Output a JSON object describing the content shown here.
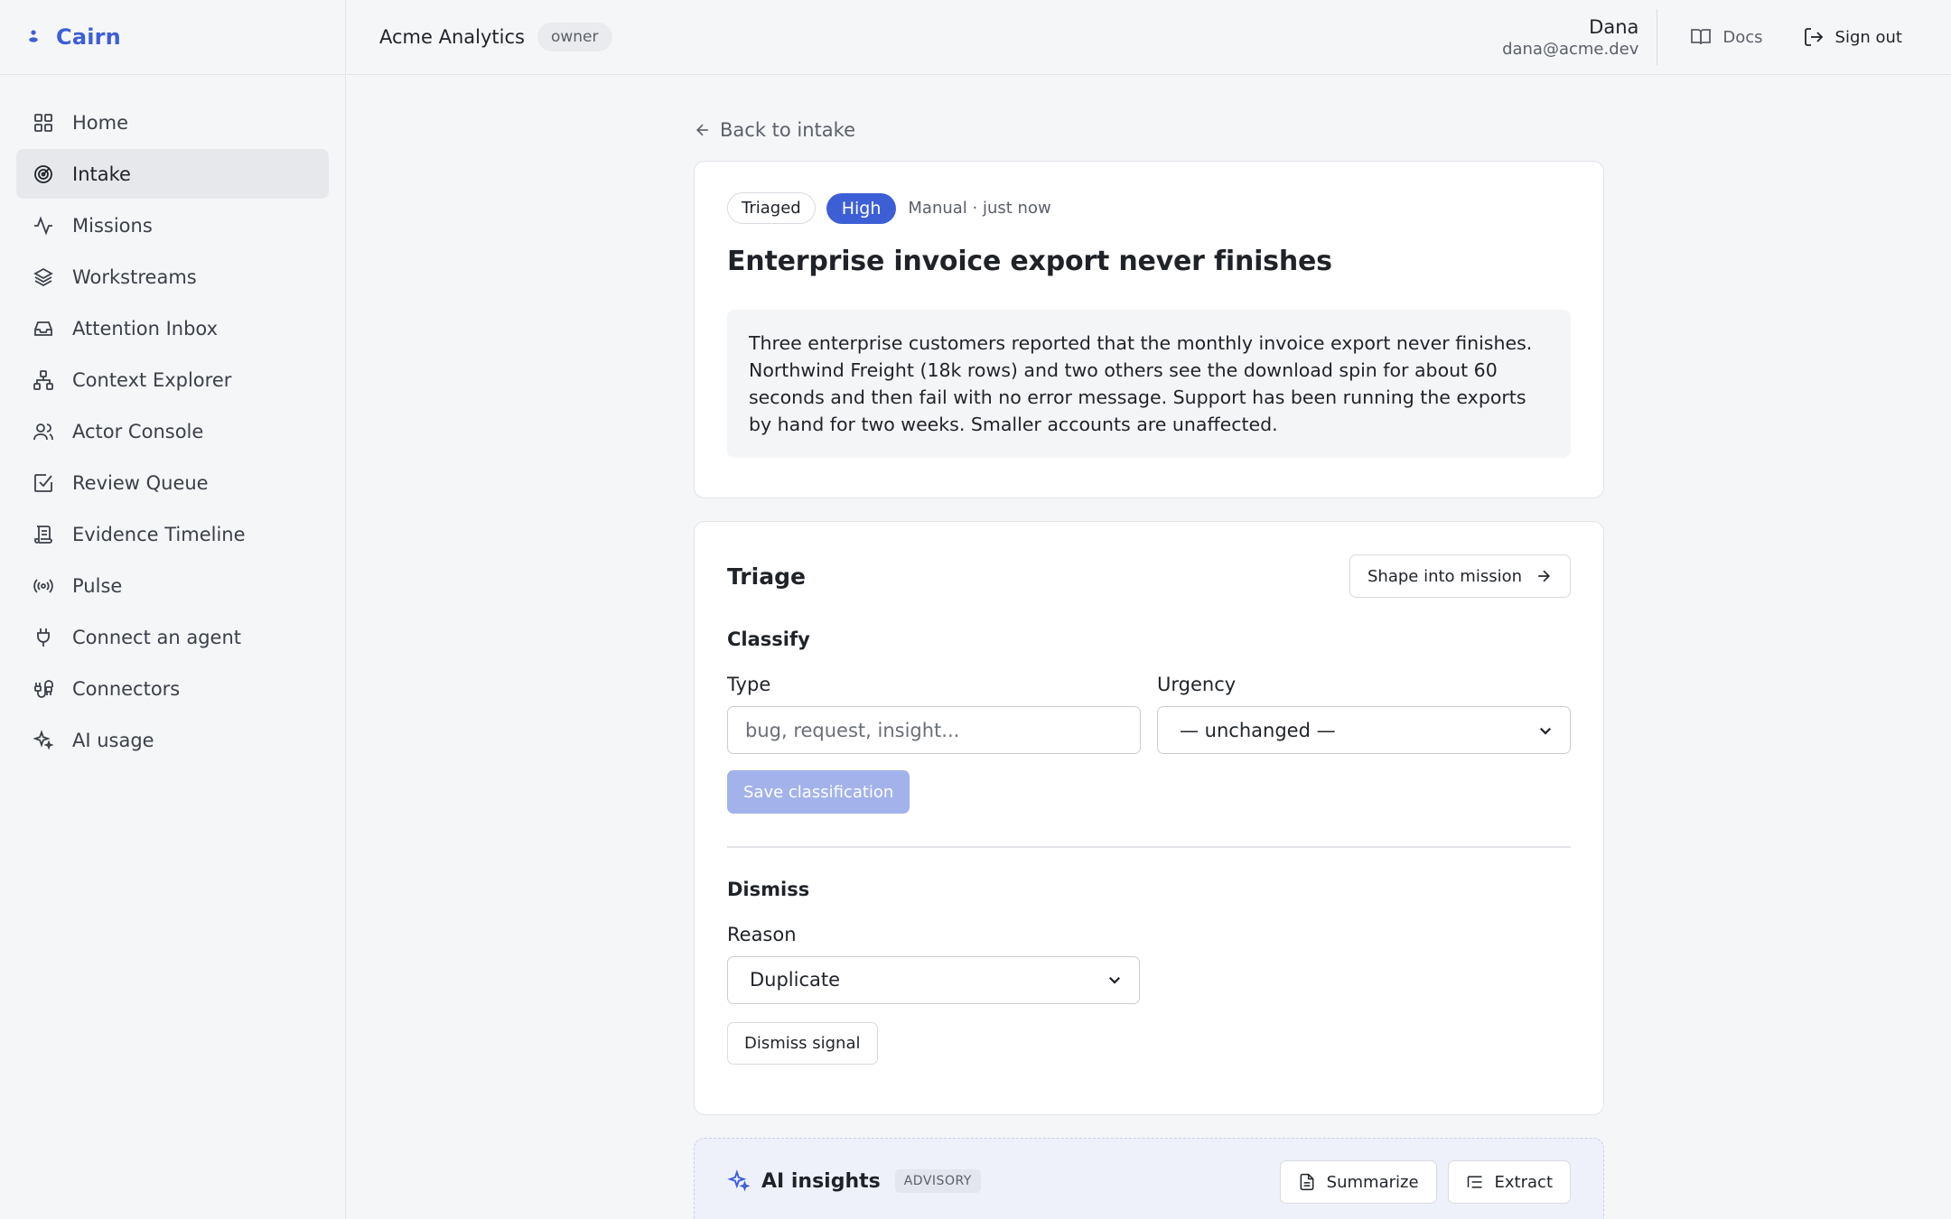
{
  "brand": {
    "name": "Cairn"
  },
  "sidebar": {
    "items": [
      {
        "label": "Home",
        "icon": "grid-icon"
      },
      {
        "label": "Intake",
        "icon": "target-icon",
        "active": true
      },
      {
        "label": "Missions",
        "icon": "activity-icon"
      },
      {
        "label": "Workstreams",
        "icon": "layers-icon"
      },
      {
        "label": "Attention Inbox",
        "icon": "inbox-icon"
      },
      {
        "label": "Context Explorer",
        "icon": "network-icon"
      },
      {
        "label": "Actor Console",
        "icon": "users-icon"
      },
      {
        "label": "Review Queue",
        "icon": "check-square-icon"
      },
      {
        "label": "Evidence Timeline",
        "icon": "scroll-icon"
      },
      {
        "label": "Pulse",
        "icon": "radio-icon"
      },
      {
        "label": "Connect an agent",
        "icon": "plug-icon"
      },
      {
        "label": "Connectors",
        "icon": "cable-icon"
      },
      {
        "label": "AI usage",
        "icon": "sparkles-icon"
      }
    ]
  },
  "topbar": {
    "org": "Acme Analytics",
    "role": "owner",
    "user_name": "Dana",
    "user_email": "dana@acme.dev",
    "docs_label": "Docs",
    "signout_label": "Sign out"
  },
  "main": {
    "back_label": "Back to intake",
    "signal": {
      "status": "Triaged",
      "priority": "High",
      "meta": "Manual · just now",
      "title": "Enterprise invoice export never finishes",
      "description": "Three enterprise customers reported that the monthly invoice export never finishes. Northwind Freight (18k rows) and two others see the download spin for about 60 seconds and then fail with no error message. Support has been running the exports by hand for two weeks. Smaller accounts are unaffected."
    },
    "triage": {
      "title": "Triage",
      "shape_button": "Shape into mission",
      "classify_heading": "Classify",
      "type_label": "Type",
      "type_placeholder": "bug, request, insight...",
      "urgency_label": "Urgency",
      "urgency_value": "— unchanged —",
      "save_button": "Save classification",
      "dismiss_heading": "Dismiss",
      "reason_label": "Reason",
      "reason_value": "Duplicate",
      "dismiss_button": "Dismiss signal"
    },
    "ai": {
      "title": "AI insights",
      "badge": "ADVISORY",
      "summarize_button": "Summarize",
      "extract_button": "Extract"
    }
  },
  "colors": {
    "accent": "#3d5fd6",
    "accent_disabled": "#a3b2ea"
  }
}
